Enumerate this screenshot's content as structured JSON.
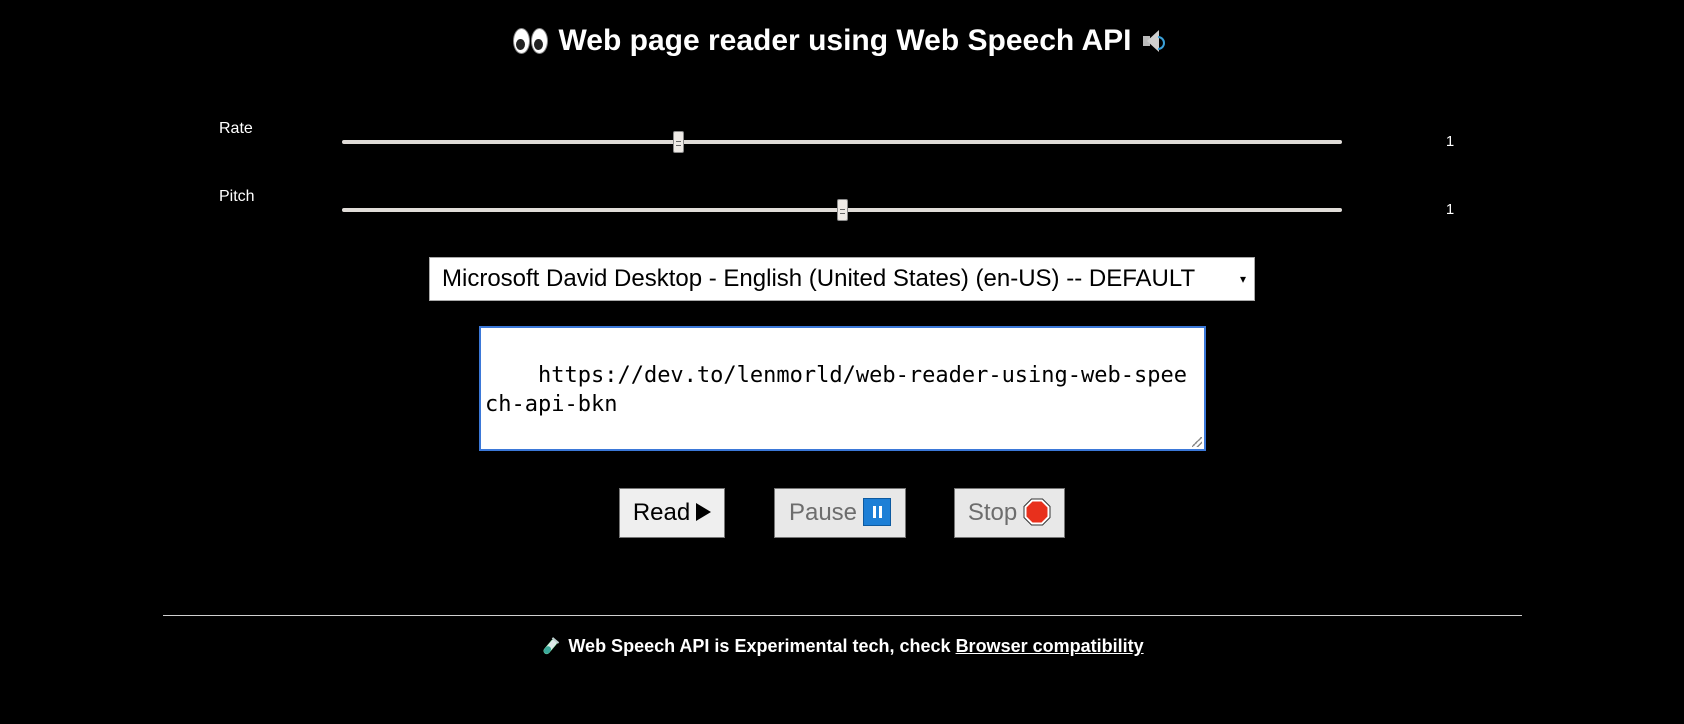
{
  "header": {
    "title": "Web page reader using Web Speech API",
    "left_icon": "eyes-icon",
    "right_icon": "speaker-icon"
  },
  "controls": {
    "rate": {
      "label": "Rate",
      "value": "1",
      "fraction": 0.335
    },
    "pitch": {
      "label": "Pitch",
      "value": "1",
      "fraction": 0.5
    }
  },
  "voice_select": {
    "selected": "Microsoft David Desktop - English (United States) (en-US) -- DEFAULT",
    "arrow": "▾"
  },
  "url_input": {
    "value": "https://dev.to/lenmorld/web-reader-using-web-speech-api-bkn"
  },
  "buttons": {
    "read": {
      "label": "Read",
      "icon": "play-icon"
    },
    "pause": {
      "label": "Pause",
      "icon": "pause-icon",
      "enabled": false
    },
    "stop": {
      "label": "Stop",
      "icon": "stop-icon",
      "enabled": false
    }
  },
  "footer": {
    "text": "Web Speech API is Experimental tech, check",
    "link_text": "Browser compatibility",
    "icon": "test-tube-icon"
  },
  "colors": {
    "background": "#000000",
    "text": "#ffffff",
    "textarea_focus_border": "#3b78d8",
    "pause_icon": "#1d7fd6",
    "stop_icon": "#e8301c"
  }
}
